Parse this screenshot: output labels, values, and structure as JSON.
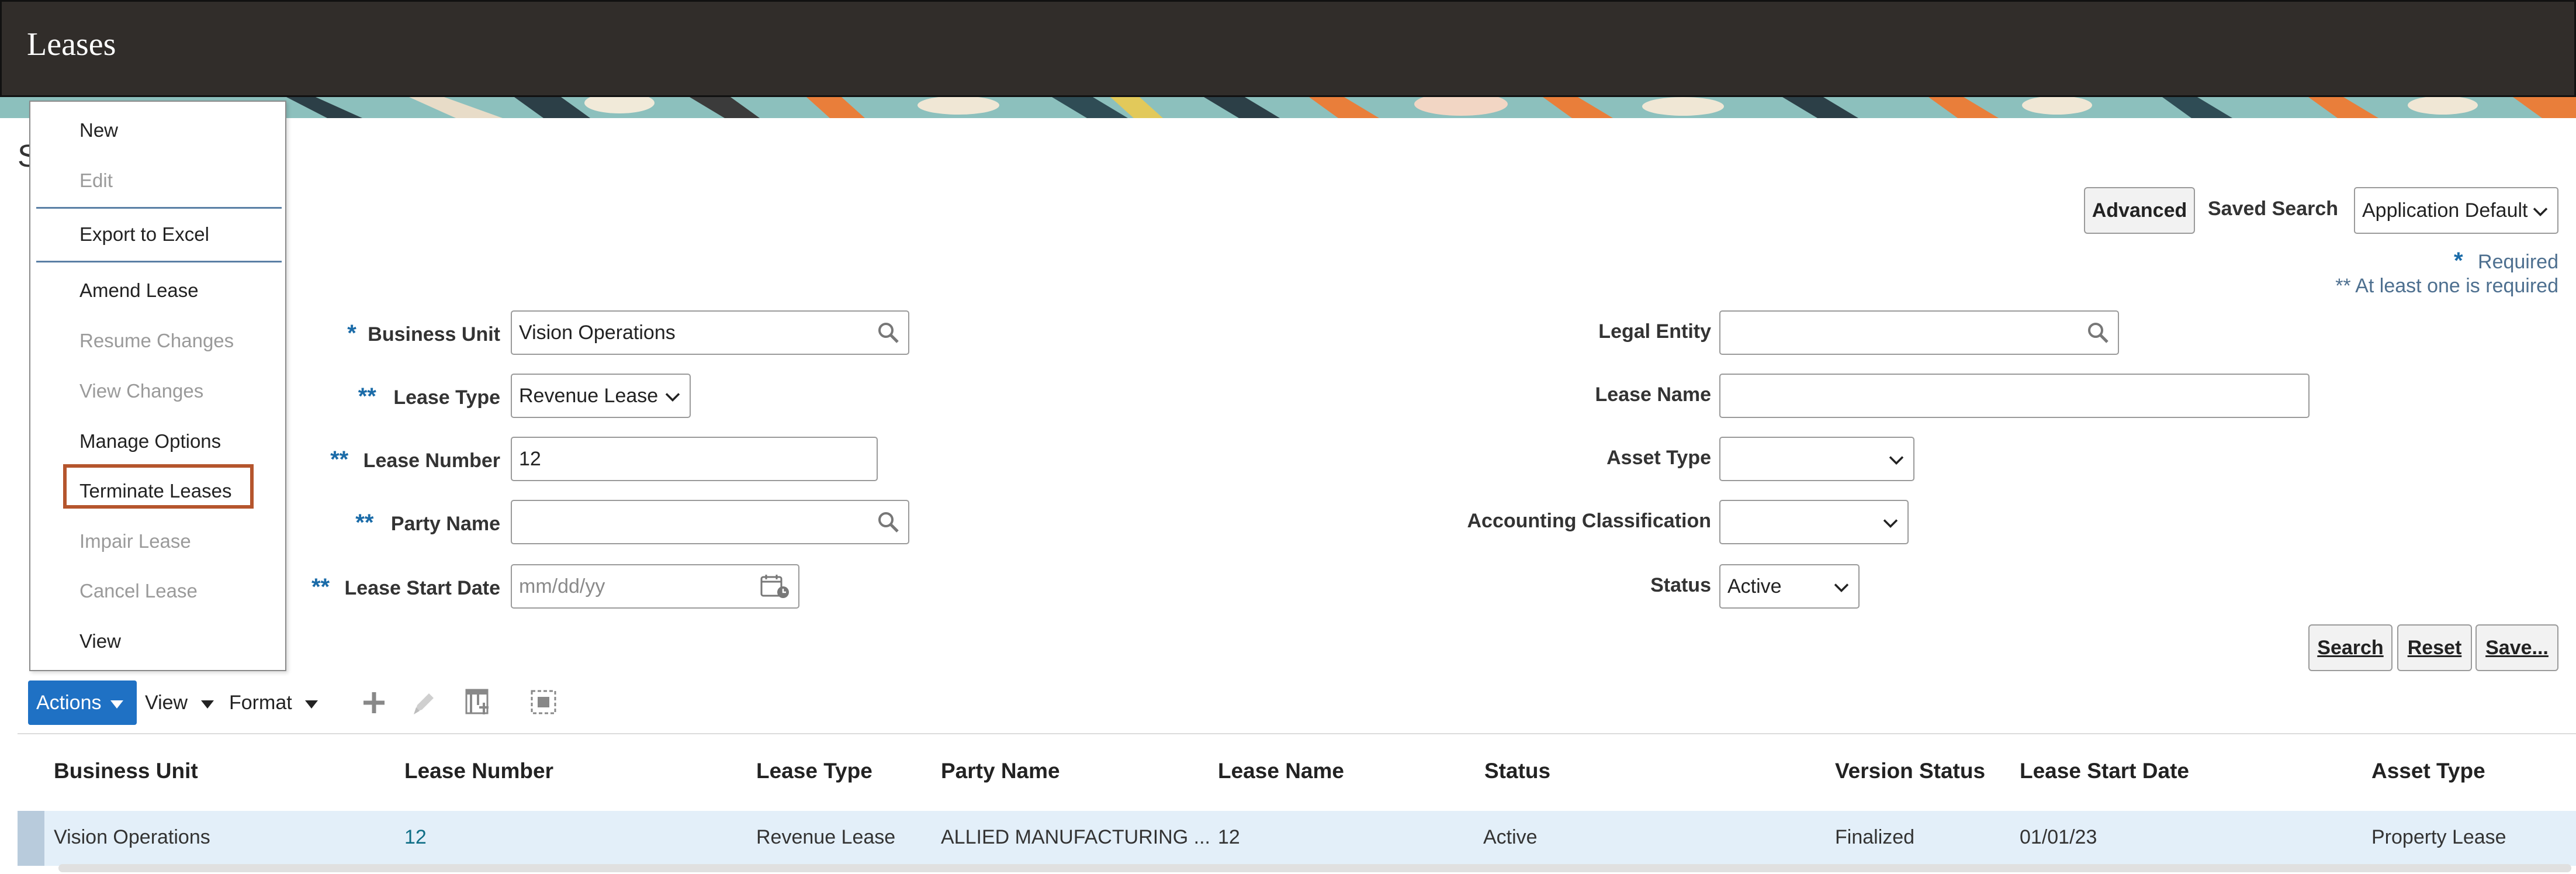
{
  "header": {
    "title": "Leases"
  },
  "search": {
    "cut_letter": "S",
    "advanced_label": "Advanced",
    "saved_search_label": "Saved Search",
    "saved_search_value": "Application Default",
    "required_star": "*",
    "required_text": "Required",
    "at_least_one_text": "** At least one is required",
    "fields": {
      "business_unit": {
        "marker": "*",
        "label": "Business Unit",
        "value": "Vision Operations"
      },
      "lease_type": {
        "marker": "**",
        "label": "Lease Type",
        "value": "Revenue Lease"
      },
      "lease_number": {
        "marker": "**",
        "label": "Lease Number",
        "value": "12"
      },
      "party_name": {
        "marker": "**",
        "label": "Party Name",
        "value": ""
      },
      "lease_start_date": {
        "marker": "**",
        "label": "Lease Start Date",
        "placeholder": "mm/dd/yy"
      },
      "legal_entity": {
        "label": "Legal Entity",
        "value": ""
      },
      "lease_name": {
        "label": "Lease Name",
        "value": ""
      },
      "asset_type": {
        "label": "Asset Type",
        "value": ""
      },
      "accounting_classification": {
        "label": "Accounting Classification",
        "value": ""
      },
      "status": {
        "label": "Status",
        "value": "Active"
      }
    },
    "search_btn": "Search",
    "reset_btn": "Reset",
    "save_btn": "Save..."
  },
  "actions_menu": {
    "items": [
      {
        "label": "New",
        "enabled": true
      },
      {
        "label": "Edit",
        "enabled": false
      },
      {
        "label": "Export to Excel",
        "enabled": true
      },
      {
        "label": "Amend Lease",
        "enabled": true
      },
      {
        "label": "Resume Changes",
        "enabled": false
      },
      {
        "label": "View Changes",
        "enabled": false
      },
      {
        "label": "Manage Options",
        "enabled": true
      },
      {
        "label": "Terminate Leases",
        "enabled": true,
        "highlighted": true
      },
      {
        "label": "Impair Lease",
        "enabled": false
      },
      {
        "label": "Cancel Lease",
        "enabled": false
      },
      {
        "label": "View",
        "enabled": true
      }
    ]
  },
  "toolbar": {
    "actions": "Actions",
    "view": "View",
    "format": "Format",
    "icons": [
      "add-icon",
      "edit-icon",
      "freeze-icon",
      "detach-icon"
    ]
  },
  "table": {
    "columns": [
      "Business Unit",
      "Lease Number",
      "Lease Type",
      "Party Name",
      "Lease Name",
      "Status",
      "Version Status",
      "Lease Start Date",
      "Asset Type"
    ],
    "rows": [
      [
        "Vision Operations",
        "12",
        "Revenue Lease",
        "ALLIED MANUFACTURING ...",
        "12",
        "Active",
        "Finalized",
        "01/01/23",
        "Property Lease"
      ]
    ]
  },
  "colors": {
    "header_bg": "#312d2a",
    "accent_blue": "#1f71c4",
    "link_teal": "#0f6e86",
    "highlight_box": "#b5552d",
    "selected_row": "#e3eff9"
  }
}
